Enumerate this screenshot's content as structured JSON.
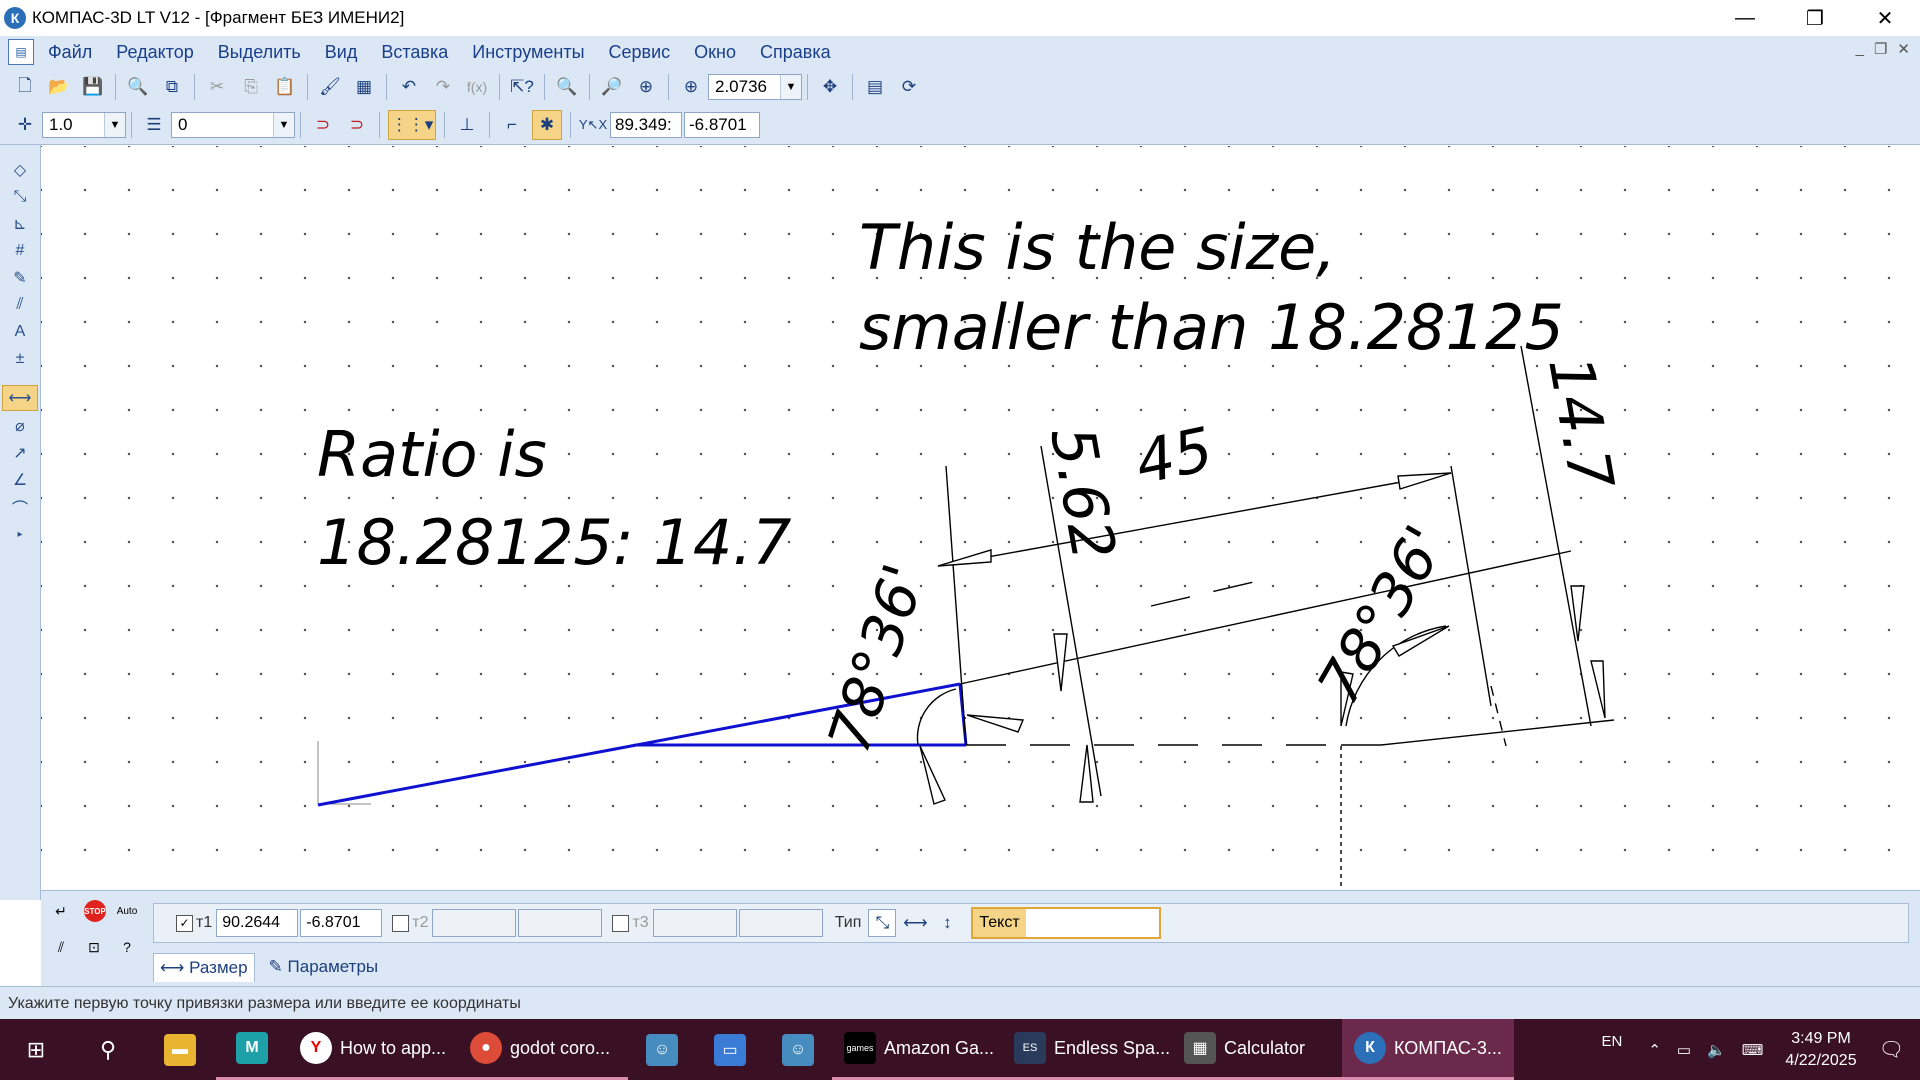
{
  "window": {
    "title": "КОМПАС-3D LT V12 - [Фрагмент БЕЗ ИМЕНИ2]",
    "logo": "К"
  },
  "menu": {
    "items": [
      "Файл",
      "Редактор",
      "Выделить",
      "Вид",
      "Вставка",
      "Инструменты",
      "Сервис",
      "Окно",
      "Справка"
    ]
  },
  "toolbar1": {
    "zoom": "2.0736"
  },
  "toolbar2": {
    "step": "1.0",
    "layer": "0",
    "coord_x": "89.349:",
    "coord_y": "-6.8701"
  },
  "drawing": {
    "note1_line1": "This is the size,",
    "note1_line2": "smaller than 18.28125",
    "note2_line1": "Ratio is",
    "note2_line2": "18.28125: 14.7",
    "dim_45": "45",
    "dim_562": "5.62",
    "dim_147": "14.7",
    "angle1": "78°36'",
    "angle2": "78°36'"
  },
  "properties": {
    "t1_label": "т1",
    "t1_x": "90.2644",
    "t1_y": "-6.8701",
    "t2_label": "т2",
    "t3_label": "т3",
    "type_label": "Тип",
    "text_label": "Текст",
    "tab_size": "Размер",
    "tab_params": "Параметры"
  },
  "status": {
    "text": "Укажите первую точку привязки размера или введите ее координаты"
  },
  "taskbar": {
    "items": [
      {
        "label": "How to app...",
        "icon": "yandex-browser-icon"
      },
      {
        "label": "godot coro...",
        "icon": "chrome-icon"
      },
      {
        "label": "Amazon Ga...",
        "icon": "amazon-games-icon"
      },
      {
        "label": "Endless Spa...",
        "icon": "endless-space-icon"
      },
      {
        "label": "Calculator",
        "icon": "calculator-icon"
      },
      {
        "label": "КОМПАС-3...",
        "icon": "kompas-icon"
      }
    ],
    "lang": "EN",
    "time": "3:49 PM",
    "date": "4/22/2025"
  }
}
